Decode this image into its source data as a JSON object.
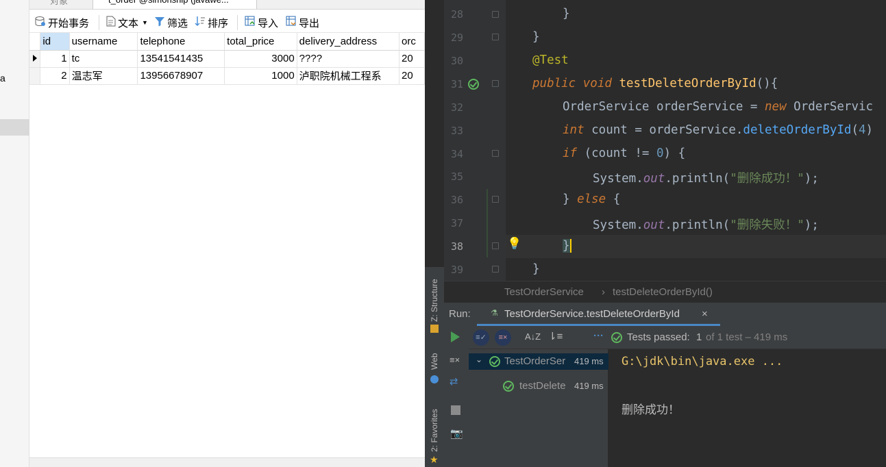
{
  "left": {
    "partial_tab_1": "对象",
    "partial_tab_2": "t_order @simonship (javawe...",
    "left_stub_char": "a",
    "toolbar": {
      "begin_tx": "开始事务",
      "text": "文本",
      "filter": "筛选",
      "sort": "排序",
      "import": "导入",
      "export": "导出"
    },
    "grid": {
      "columns": [
        "id",
        "username",
        "telephone",
        "total_price",
        "delivery_address",
        "orc"
      ],
      "rows": [
        [
          "1",
          "tc",
          "13541541435",
          "3000",
          "????",
          "20"
        ],
        [
          "2",
          "温志军",
          "13956678907",
          "1000",
          "泸职院机械工程系",
          "20"
        ]
      ]
    }
  },
  "ide": {
    "lines": [
      "28",
      "29",
      "30",
      "31",
      "32",
      "33",
      "34",
      "35",
      "36",
      "37",
      "38",
      "39"
    ],
    "code": {
      "l28": "}",
      "l29": "}",
      "l30": "@Test",
      "l31_kw": "public void ",
      "l31_fn": "testDeleteOrderById",
      "l31_rest": "(){",
      "l32_a": "OrderService orderService = ",
      "l32_kw": "new",
      "l32_b": " OrderServic",
      "l33_kw": "int",
      "l33_a": " count = orderService.",
      "l33_m": "deleteOrderById",
      "l33_b": "(",
      "l33_n": "4",
      "l33_c": ")",
      "l34_kw": "if",
      "l34_a": " (count != ",
      "l34_n": "0",
      "l34_b": ") {",
      "l35_a": "System.",
      "l35_out": "out",
      "l35_b": ".println(",
      "l35_s": "\"删除成功！\"",
      "l35_c": ");",
      "l36_a": "} ",
      "l36_kw": "else",
      "l36_b": " {",
      "l37_a": "System.",
      "l37_out": "out",
      "l37_b": ".println(",
      "l37_s": "\"删除失败！\"",
      "l37_c": ");",
      "l38": "}",
      "l39": "}"
    },
    "breadcrumb": {
      "class": "TestOrderService",
      "sep": "›",
      "method": "testDeleteOrderById()"
    },
    "sidebar": {
      "structure": "Z: Structure",
      "web": "Web",
      "favorites": "2: Favorites"
    },
    "run": {
      "label": "Run:",
      "tab": "TestOrderService.testDeleteOrderById",
      "tests_passed": "Tests passed:",
      "passed_count": "1",
      "of_text": "of 1 test – 419 ms",
      "tree": [
        {
          "name": "TestOrderSer",
          "time": "419 ms"
        },
        {
          "name": "testDelete",
          "time": "419 ms"
        }
      ],
      "console": [
        "G:\\jdk\\bin\\java.exe ...",
        "删除成功！"
      ]
    },
    "colors": {
      "bg": "#2b2b2b",
      "keyword": "#cc7832",
      "function": "#ffc66d",
      "string": "#6a8759",
      "number": "#6897bb",
      "annotation": "#bbb529",
      "pass": "#5fb85f"
    }
  }
}
